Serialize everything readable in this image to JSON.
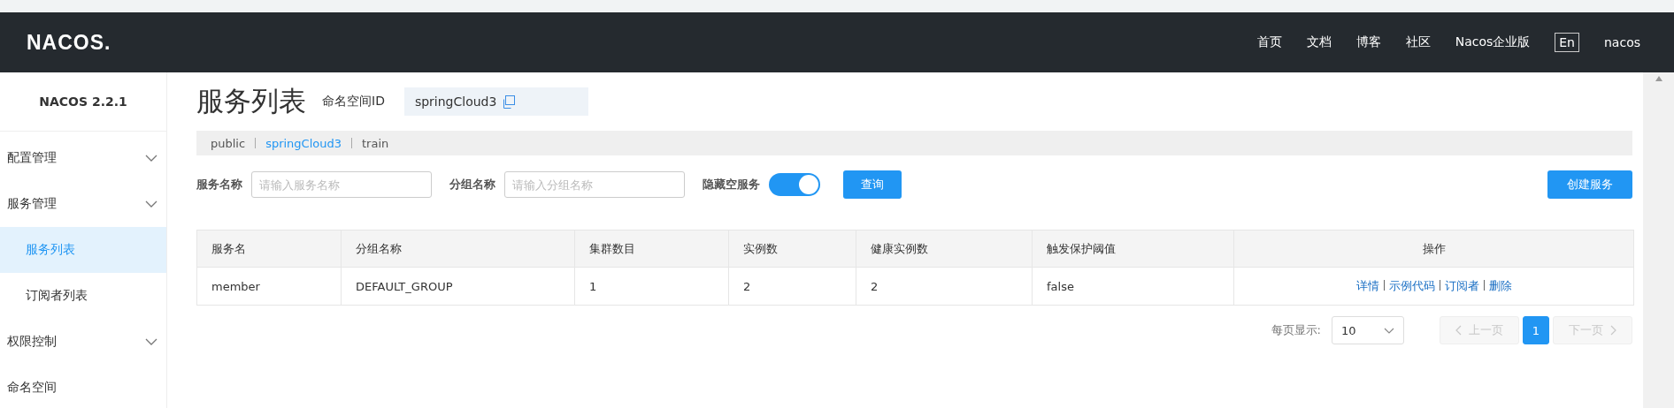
{
  "header": {
    "logo": "NACOS.",
    "nav": [
      "首页",
      "文档",
      "博客",
      "社区",
      "Nacos企业版"
    ],
    "language": "En",
    "user": "nacos"
  },
  "sidebar": {
    "version": "NACOS 2.2.1",
    "items": [
      {
        "label": "配置管理",
        "kind": "group",
        "selected": false
      },
      {
        "label": "服务管理",
        "kind": "group",
        "selected": false
      },
      {
        "label": "服务列表",
        "kind": "child",
        "selected": true
      },
      {
        "label": "订阅者列表",
        "kind": "child",
        "selected": false
      },
      {
        "label": "权限控制",
        "kind": "group",
        "selected": false
      },
      {
        "label": "命名空间",
        "kind": "link",
        "selected": false
      }
    ]
  },
  "page": {
    "title": "服务列表",
    "namespace_label": "命名空间ID",
    "namespace_id": "springCloud3"
  },
  "namespaces": [
    {
      "label": "public",
      "selected": false
    },
    {
      "label": "springCloud3",
      "selected": true
    },
    {
      "label": "train",
      "selected": false
    }
  ],
  "filters": {
    "service_label": "服务名称",
    "service_placeholder": "请输入服务名称",
    "group_label": "分组名称",
    "group_placeholder": "请输入分组名称",
    "hide_empty_label": "隐藏空服务",
    "hide_empty_on": true,
    "query_button": "查询",
    "create_button": "创建服务"
  },
  "table": {
    "columns": [
      "服务名",
      "分组名称",
      "集群数目",
      "实例数",
      "健康实例数",
      "触发保护阈值",
      "操作"
    ],
    "rows": [
      {
        "cells": [
          "member",
          "DEFAULT_GROUP",
          "1",
          "2",
          "2",
          "false"
        ],
        "actions": [
          "详情",
          "示例代码",
          "订阅者",
          "删除"
        ]
      }
    ]
  },
  "pagination": {
    "page_size_label": "每页显示:",
    "page_size": "10",
    "prev": "上一页",
    "prev_disabled": true,
    "pages": [
      {
        "label": "1",
        "selected": true
      }
    ],
    "next": "下一页",
    "next_disabled": true
  }
}
